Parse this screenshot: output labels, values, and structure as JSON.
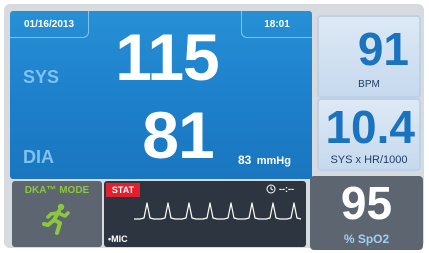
{
  "header": {
    "date": "01/16/2013",
    "time": "18:01"
  },
  "bp": {
    "sys_label": "SYS",
    "sys_value": "115",
    "dia_label": "DIA",
    "dia_value": "81",
    "map_value": "83",
    "map_unit": "mmHg"
  },
  "heart_rate": {
    "value": "91",
    "unit": "BPM"
  },
  "shock_index": {
    "value": "10.4",
    "unit": "SYS x HR/1000"
  },
  "mode": {
    "label": "DKA™ MODE",
    "icon": "running-person-icon"
  },
  "waveform": {
    "badge": "STAT",
    "timer": "--:--",
    "source": "•MIC"
  },
  "spo2": {
    "value": "95",
    "unit": "% SpO2"
  },
  "colors": {
    "bp_panel": "#1d7fca",
    "label_blue": "#7fc1ef",
    "value_blue": "#1a73bf",
    "mode_green": "#8dc63f",
    "stat_red": "#e21f2d",
    "dark_panel": "#2d3640",
    "grey_panel": "#5d6670"
  }
}
